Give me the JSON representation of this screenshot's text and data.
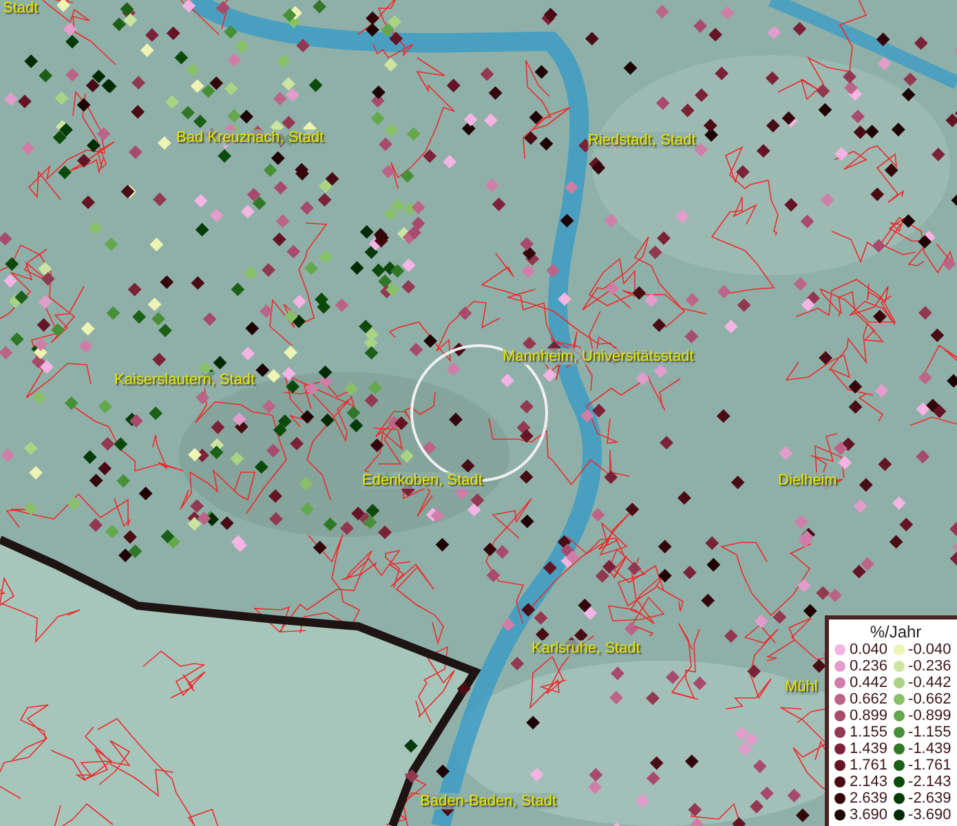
{
  "map": {
    "labels": [
      {
        "text": "Stadt"
      },
      {
        "text": "Bad Kreuznach, Stadt"
      },
      {
        "text": "Riedstadt, Stadt"
      },
      {
        "text": "Kaiserslautern, Stadt"
      },
      {
        "text": "Mannheim, Universitätsstadt"
      },
      {
        "text": "Edenkoben, Stadt"
      },
      {
        "text": "Dielheim"
      },
      {
        "text": "Karlsruhe, Stadt"
      },
      {
        "text": "Mühl"
      },
      {
        "text": "Baden-Baden, Stadt"
      }
    ]
  },
  "legend": {
    "title": "%/Jahr",
    "positive": [
      {
        "label": "0.040",
        "color": "#f4b4e4"
      },
      {
        "label": "0.236",
        "color": "#e49ccc"
      },
      {
        "label": "0.442",
        "color": "#d07ea8"
      },
      {
        "label": "0.662",
        "color": "#bc6488"
      },
      {
        "label": "0.899",
        "color": "#a84a6c"
      },
      {
        "label": "1.155",
        "color": "#923850"
      },
      {
        "label": "1.439",
        "color": "#7c2238"
      },
      {
        "label": "1.761",
        "color": "#641424"
      },
      {
        "label": "2.143",
        "color": "#4a0c14"
      },
      {
        "label": "2.639",
        "color": "#34060c"
      },
      {
        "label": "3.690",
        "color": "#1e0204"
      }
    ],
    "negative": [
      {
        "label": "-0.040",
        "color": "#eef4b4"
      },
      {
        "label": "-0.236",
        "color": "#cce4a0"
      },
      {
        "label": "-0.442",
        "color": "#aad484"
      },
      {
        "label": "-0.662",
        "color": "#88c068"
      },
      {
        "label": "-0.899",
        "color": "#64a84c"
      },
      {
        "label": "-1.155",
        "color": "#489038"
      },
      {
        "label": "-1.439",
        "color": "#307828"
      },
      {
        "label": "-1.761",
        "color": "#1c6018"
      },
      {
        "label": "-2.143",
        "color": "#0c4a0c"
      },
      {
        "label": "-2.639",
        "color": "#063a08"
      },
      {
        "label": "-3.690",
        "color": "#022a04"
      }
    ]
  }
}
